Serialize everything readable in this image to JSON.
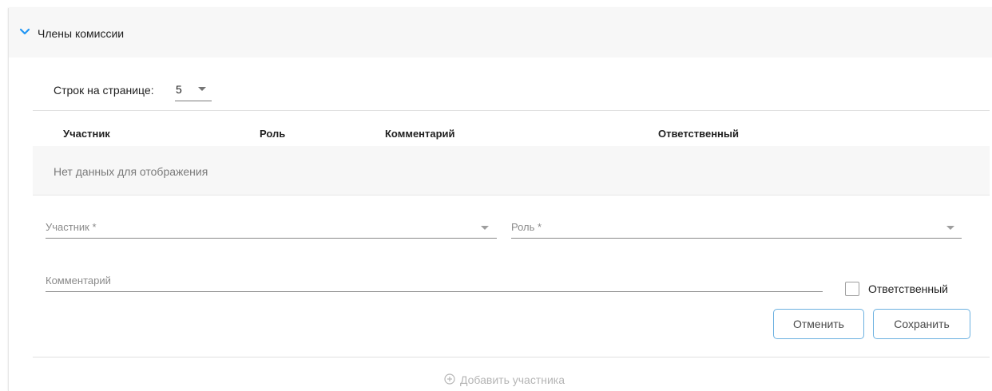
{
  "section": {
    "title": "Члены комиссии",
    "expanded": true,
    "icon": "chevron-down-icon"
  },
  "pagination": {
    "rows_label": "Строк на странице:",
    "rows_value": "5"
  },
  "table": {
    "columns": [
      "Участник",
      "Роль",
      "Комментарий",
      "Ответственный"
    ],
    "empty_text": "Нет данных для отображения"
  },
  "form": {
    "participant_label": "Участник *",
    "role_label": "Роль *",
    "comment_label": "Комментарий",
    "responsible_label": "Ответственный",
    "responsible_checked": false,
    "cancel_label": "Отменить",
    "save_label": "Сохранить"
  },
  "add_participant": {
    "label": "Добавить участника",
    "icon": "plus-circle-icon"
  },
  "colors": {
    "accent": "#2196f3",
    "button_border": "#6bb0e0",
    "header_bg": "#f7f7f7",
    "muted_text": "#8a8a8a",
    "disabled_text": "#b5b5b5"
  }
}
